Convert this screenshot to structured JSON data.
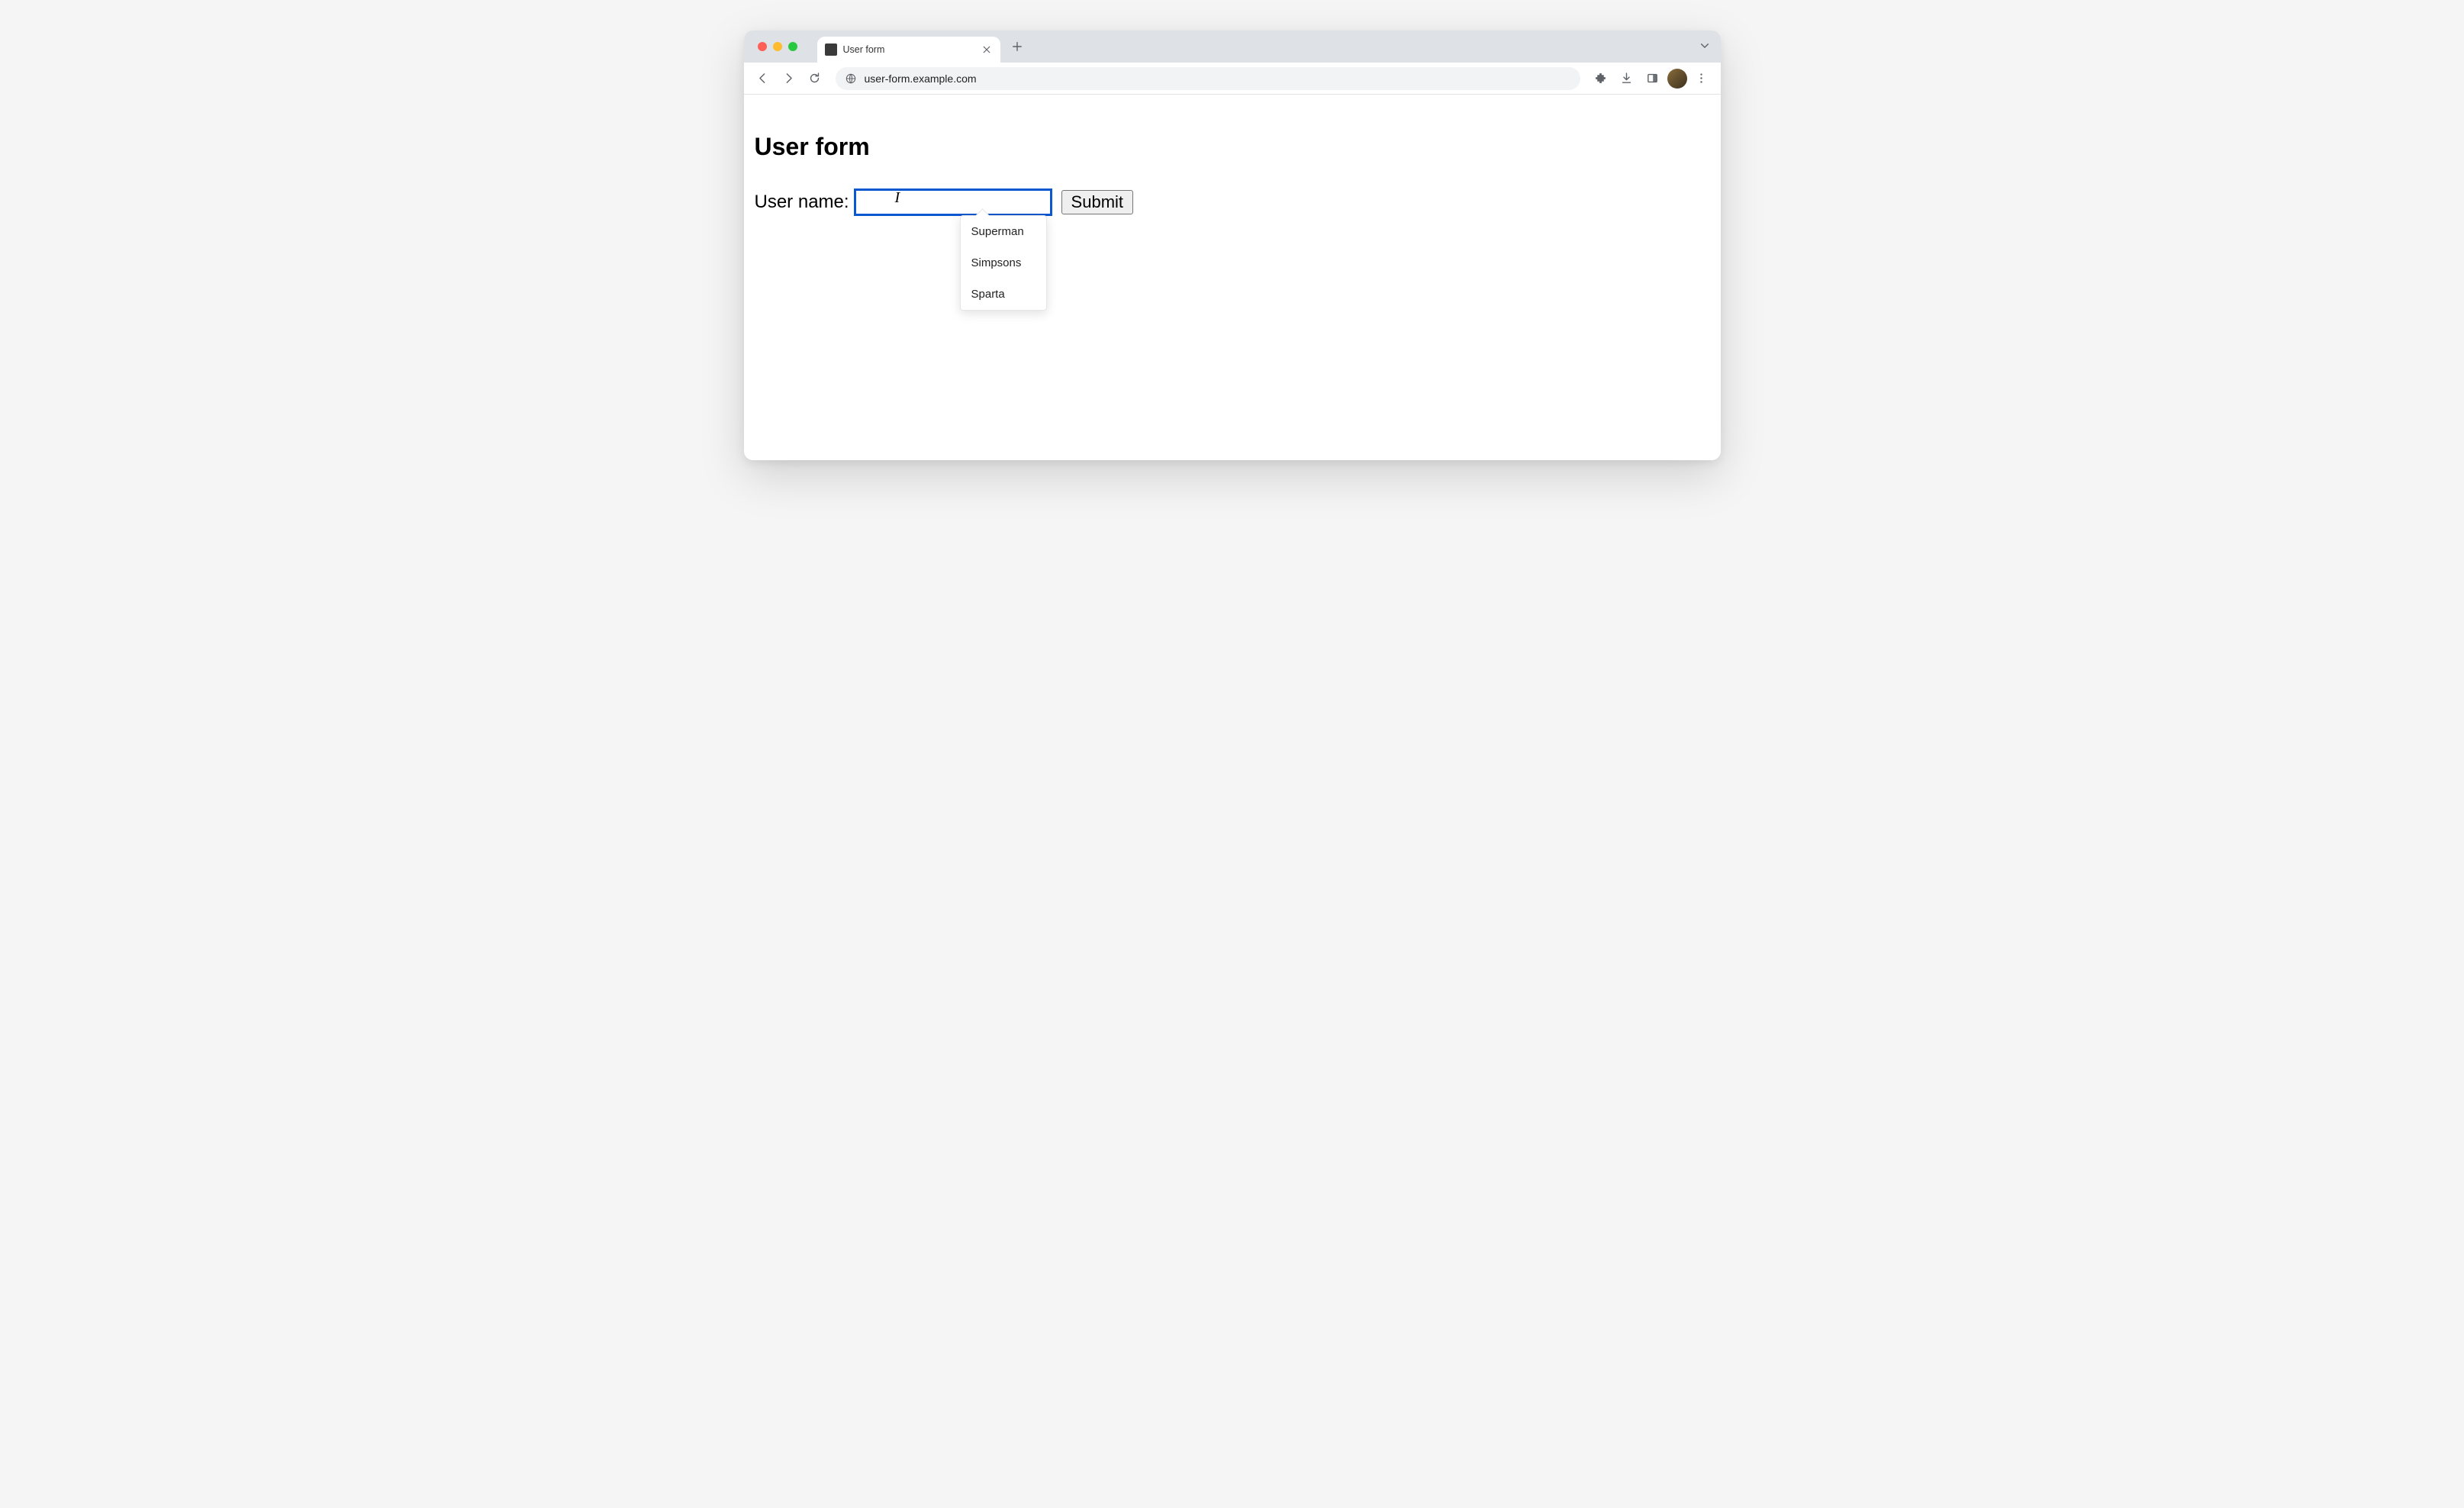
{
  "browser": {
    "tab_title": "User form",
    "url": "user-form.example.com"
  },
  "page": {
    "heading": "User form",
    "form": {
      "username_label": "User name:",
      "username_value": "",
      "submit_label": "Submit"
    },
    "autocomplete": {
      "items": [
        "Superman",
        "Simpsons",
        "Sparta"
      ]
    }
  }
}
